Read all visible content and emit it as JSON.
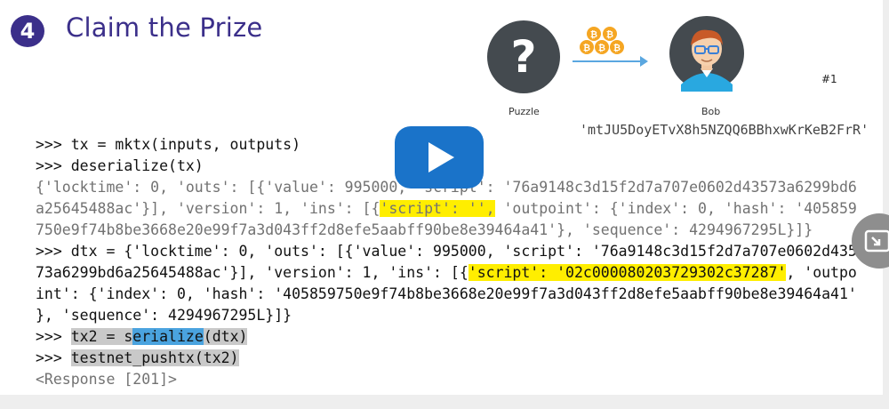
{
  "slide": {
    "step_number": "4",
    "title": "Claim the Prize",
    "slide_number": "#1",
    "diagram": {
      "puzzle_glyph": "?",
      "puzzle_label": "Puzzle",
      "coin_glyph": "₿",
      "bob_label": "Bob",
      "bob_address": "'mtJU5DoyETvX8h5NZQQ6BBhxwKrKeB2FrR'"
    }
  },
  "code": {
    "l1": ">>> tx = mktx(inputs, outputs)",
    "l2": ">>> deserialize(tx)",
    "l3a": "{'locktime': 0, 'outs': [{'value': 995000, 'script': '76a9148c3d15f2d7a707e0602d43573a6299bd6",
    "l4a": "a25645488ac'}], 'version': 1, 'ins': [{",
    "l4hl": "'script': '',",
    "l4b": " 'outpoint': {'index': 0, 'hash': '405859",
    "l5": "750e9f74b8be3668e20e99f7a3d043ff2d8efe5aabff90be8e39464a41'}, 'sequence': 4294967295L}]}",
    "l6": ">>> dtx = {'locktime': 0, 'outs': [{'value': 995000, 'script': '76a9148c3d15f2d7a707e0602d435",
    "l7a": "73a6299bd6a25645488ac'}], 'version': 1, 'ins': [{",
    "l7hl": "'script': '02c000080203729302c37287'",
    "l7b": ", 'outpo",
    "l8": "int': {'index': 0, 'hash': '405859750e9f74b8be3668e20e99f7a3d043ff2d8efe5aabff90be8e39464a41'",
    "l9": "}, 'sequence': 4294967295L}]}",
    "l10pre": ">>> ",
    "l10g1": "tx2 = s",
    "l10b": "erialize",
    "l10g2": "(dtx)",
    "l11pre": ">>> ",
    "l11g": "testnet_pushtx(tx2)",
    "l12": "<Response [201]>"
  },
  "colors": {
    "title": "#3b2f8a",
    "highlight_yellow": "#ffee00",
    "highlight_gray": "#c9c9c9",
    "selection_blue": "#4aa3df",
    "play_button": "#1a73c9",
    "output_text": "#727272"
  },
  "icons": {
    "play": "play-icon",
    "side_button": "picture-in-picture-icon",
    "coins": "bitcoin-coin-icon",
    "arrow": "arrow-right-icon"
  }
}
